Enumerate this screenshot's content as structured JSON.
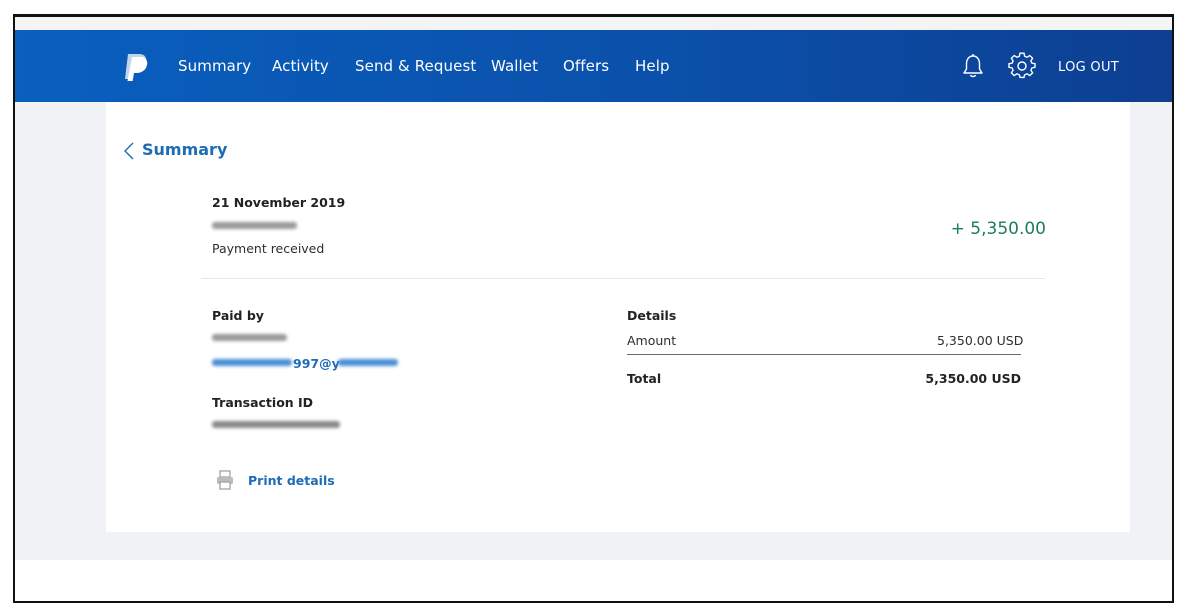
{
  "nav": {
    "items": [
      "Summary",
      "Activity",
      "Send & Request",
      "Wallet",
      "Offers",
      "Help"
    ],
    "logout": "LOG OUT"
  },
  "back": {
    "label": "Summary"
  },
  "transaction": {
    "date": "21 November 2019",
    "type": "Payment received",
    "amount": "+ 5,350.00"
  },
  "paid_by": {
    "label": "Paid by",
    "email_visible": "997@y"
  },
  "transaction_id": {
    "label": "Transaction ID"
  },
  "print": {
    "label": "Print details"
  },
  "details": {
    "title": "Details",
    "amount_label": "Amount",
    "amount_value": "5,350.00 USD",
    "total_label": "Total",
    "total_value": "5,350.00 USD"
  },
  "colors": {
    "nav_blue": "#0b4fa8",
    "link_blue": "#1c6cb8",
    "amount_green": "#1b7d5c"
  },
  "icons": [
    "paypal-logo-icon",
    "bell-icon",
    "gear-icon",
    "chevron-left-icon",
    "printer-icon"
  ]
}
